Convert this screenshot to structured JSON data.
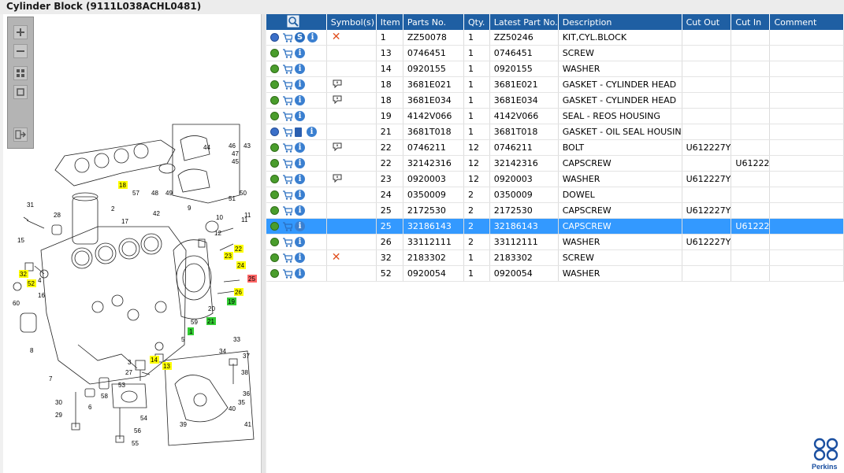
{
  "window": {
    "title": "Cylinder Block (9111L038ACHL0481)"
  },
  "toolbar": {
    "buttons": [
      {
        "name": "zoom-in-icon"
      },
      {
        "name": "zoom-out-icon"
      },
      {
        "name": "fit-page-icon"
      },
      {
        "name": "actual-size-icon"
      },
      {
        "name": "export-icon"
      }
    ]
  },
  "table": {
    "columns": [
      "",
      "Symbol(s)",
      "Item",
      "Parts No.",
      "Qty.",
      "Latest Part No.",
      "Description",
      "Cut Out",
      "Cut In",
      "Comment"
    ],
    "rows": [
      {
        "icons": "gear-blue,cart,s,info",
        "symbol": "x",
        "item": "1",
        "part": "ZZ50078",
        "qty": "1",
        "latest": "ZZ50246",
        "desc": "KIT,CYL.BLOCK",
        "cutout": "",
        "cutin": "",
        "comment": ""
      },
      {
        "icons": "gear,cart,info",
        "symbol": "",
        "item": "13",
        "part": "0746451",
        "qty": "1",
        "latest": "0746451",
        "desc": "SCREW",
        "cutout": "",
        "cutin": "",
        "comment": ""
      },
      {
        "icons": "gear,cart,info",
        "symbol": "",
        "item": "14",
        "part": "0920155",
        "qty": "1",
        "latest": "0920155",
        "desc": "WASHER",
        "cutout": "",
        "cutin": "",
        "comment": ""
      },
      {
        "icons": "gear,cart,info",
        "symbol": "bubble",
        "item": "18",
        "part": "3681E021",
        "qty": "1",
        "latest": "3681E021",
        "desc": "GASKET - CYLINDER HEAD",
        "cutout": "",
        "cutin": "",
        "comment": ""
      },
      {
        "icons": "gear,cart,info",
        "symbol": "bubble",
        "item": "18",
        "part": "3681E034",
        "qty": "1",
        "latest": "3681E034",
        "desc": "GASKET - CYLINDER HEAD",
        "cutout": "",
        "cutin": "",
        "comment": ""
      },
      {
        "icons": "gear,cart,info",
        "symbol": "",
        "item": "19",
        "part": "4142V066",
        "qty": "1",
        "latest": "4142V066",
        "desc": "SEAL - REOS HOUSING",
        "cutout": "",
        "cutin": "",
        "comment": ""
      },
      {
        "icons": "gear-blue,cart,book,info",
        "symbol": "",
        "item": "21",
        "part": "3681T018",
        "qty": "1",
        "latest": "3681T018",
        "desc": "GASKET - OIL SEAL HOUSIN",
        "cutout": "",
        "cutin": "",
        "comment": ""
      },
      {
        "icons": "gear,cart,info",
        "symbol": "bubble",
        "item": "22",
        "part": "0746211",
        "qty": "12",
        "latest": "0746211",
        "desc": "BOLT",
        "cutout": "U612227Y",
        "cutin": "",
        "comment": ""
      },
      {
        "icons": "gear,cart,info",
        "symbol": "",
        "item": "22",
        "part": "32142316",
        "qty": "12",
        "latest": "32142316",
        "desc": "CAPSCREW",
        "cutout": "",
        "cutin": "U61222",
        "comment": ""
      },
      {
        "icons": "gear,cart,info",
        "symbol": "bubble",
        "item": "23",
        "part": "0920003",
        "qty": "12",
        "latest": "0920003",
        "desc": "WASHER",
        "cutout": "U612227Y",
        "cutin": "",
        "comment": ""
      },
      {
        "icons": "gear,cart,info",
        "symbol": "",
        "item": "24",
        "part": "0350009",
        "qty": "2",
        "latest": "0350009",
        "desc": "DOWEL",
        "cutout": "",
        "cutin": "",
        "comment": ""
      },
      {
        "icons": "gear,cart,info",
        "symbol": "",
        "item": "25",
        "part": "2172530",
        "qty": "2",
        "latest": "2172530",
        "desc": "CAPSCREW",
        "cutout": "U612227Y",
        "cutin": "",
        "comment": ""
      },
      {
        "icons": "gear,cart,info",
        "symbol": "",
        "item": "25",
        "part": "32186143",
        "qty": "2",
        "latest": "32186143",
        "desc": "CAPSCREW",
        "cutout": "",
        "cutin": "U61222",
        "comment": "",
        "selected": true
      },
      {
        "icons": "gear,cart,info",
        "symbol": "",
        "item": "26",
        "part": "33112111",
        "qty": "2",
        "latest": "33112111",
        "desc": "WASHER",
        "cutout": "U612227Y",
        "cutin": "",
        "comment": ""
      },
      {
        "icons": "gear,cart,info",
        "symbol": "x",
        "item": "32",
        "part": "2183302",
        "qty": "1",
        "latest": "2183302",
        "desc": "SCREW",
        "cutout": "",
        "cutin": "",
        "comment": ""
      },
      {
        "icons": "gear,cart,info",
        "symbol": "",
        "item": "52",
        "part": "0920054",
        "qty": "1",
        "latest": "0920054",
        "desc": "WASHER",
        "cutout": "",
        "cutin": "",
        "comment": ""
      }
    ]
  },
  "diagram": {
    "callouts": [
      "1",
      "2",
      "3",
      "4",
      "5",
      "6",
      "7",
      "8",
      "9",
      "10",
      "11",
      "12",
      "13",
      "14",
      "15",
      "16",
      "17",
      "18",
      "19",
      "20",
      "21",
      "22",
      "23",
      "24",
      "25",
      "26",
      "27",
      "28",
      "29",
      "30",
      "31",
      "32",
      "33",
      "34",
      "35",
      "36",
      "37",
      "38",
      "39",
      "40",
      "41",
      "42",
      "43",
      "44",
      "45",
      "46",
      "47",
      "48",
      "49",
      "50",
      "51",
      "52",
      "53",
      "54",
      "55",
      "56",
      "57",
      "58",
      "59",
      "60"
    ],
    "highlight_yellow": [
      "18",
      "22",
      "23",
      "24",
      "26",
      "32",
      "52",
      "13",
      "14"
    ],
    "highlight_green": [
      "19",
      "21",
      "1"
    ],
    "highlight_red": [
      "25"
    ]
  },
  "brand": {
    "logo_text": "Perkins"
  },
  "colors": {
    "header_bg": "#1f5fa3",
    "selection": "#3399ff",
    "highlight_yellow": "#ffff00",
    "highlight_green": "#33cc33",
    "highlight_red": "#ff6666"
  }
}
